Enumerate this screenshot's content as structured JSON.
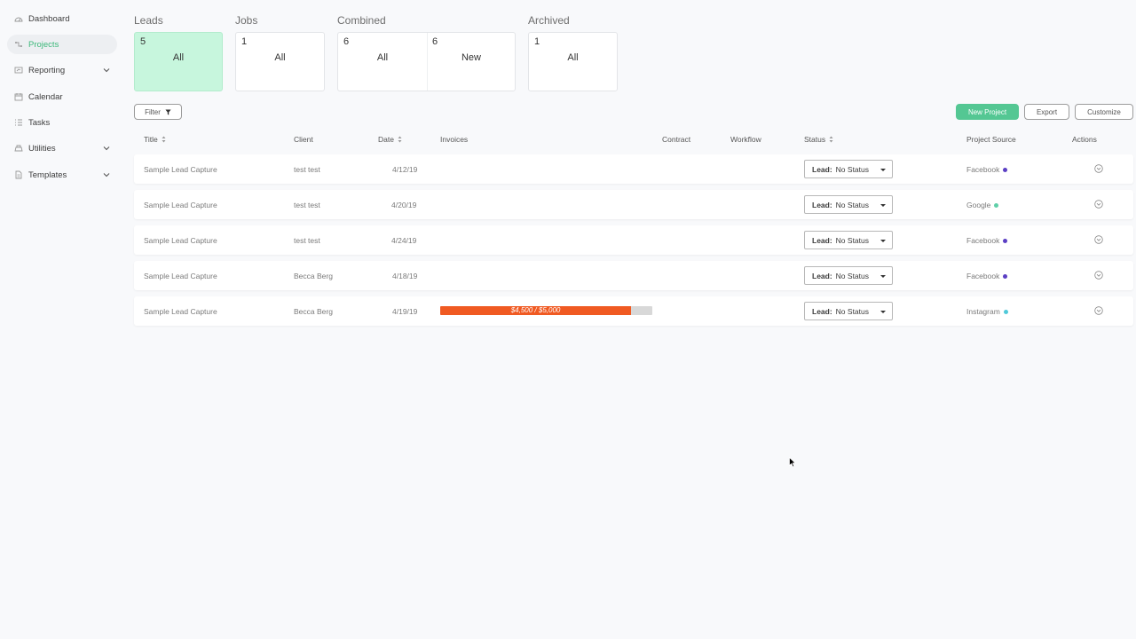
{
  "sidebar": {
    "items": [
      {
        "label": "Dashboard",
        "icon": "dashboard-icon",
        "active": false
      },
      {
        "label": "Projects",
        "icon": "projects-icon",
        "active": true
      },
      {
        "label": "Reporting",
        "icon": "reporting-icon",
        "active": false,
        "expandable": true
      },
      {
        "label": "Calendar",
        "icon": "calendar-icon",
        "active": false
      },
      {
        "label": "Tasks",
        "icon": "tasks-icon",
        "active": false
      },
      {
        "label": "Utilities",
        "icon": "utilities-icon",
        "active": false,
        "expandable": true
      },
      {
        "label": "Templates",
        "icon": "templates-icon",
        "active": false,
        "expandable": true
      }
    ]
  },
  "categories": {
    "leads": {
      "label": "Leads",
      "all_count": "5",
      "all_label": "All"
    },
    "jobs": {
      "label": "Jobs",
      "all_count": "1",
      "all_label": "All"
    },
    "combined": {
      "label": "Combined",
      "all_count": "6",
      "all_label": "All",
      "new_count": "6",
      "new_label": "New"
    },
    "archived": {
      "label": "Archived",
      "all_count": "1",
      "all_label": "All"
    }
  },
  "toolbar": {
    "filter_label": "Filter",
    "new_project_label": "New Project",
    "export_label": "Export",
    "customize_label": "Customize"
  },
  "table": {
    "headers": {
      "title": "Title",
      "client": "Client",
      "date": "Date",
      "invoices": "Invoices",
      "contract": "Contract",
      "workflow": "Workflow",
      "status": "Status",
      "source": "Project Source",
      "actions": "Actions"
    },
    "rows": [
      {
        "title": "Sample Lead Capture",
        "client": "test test",
        "date": "4/12/19",
        "invoice": "",
        "status_prefix": "Lead:",
        "status": "No Status",
        "source": "Facebook",
        "source_color": "#5b3fc4"
      },
      {
        "title": "Sample Lead Capture",
        "client": "test test",
        "date": "4/20/19",
        "invoice": "",
        "status_prefix": "Lead:",
        "status": "No Status",
        "source": "Google",
        "source_color": "#5fcfa8"
      },
      {
        "title": "Sample Lead Capture",
        "client": "test test",
        "date": "4/24/19",
        "invoice": "",
        "status_prefix": "Lead:",
        "status": "No Status",
        "source": "Facebook",
        "source_color": "#5b3fc4"
      },
      {
        "title": "Sample Lead Capture",
        "client": "Becca Berg",
        "date": "4/18/19",
        "invoice": "",
        "status_prefix": "Lead:",
        "status": "No Status",
        "source": "Facebook",
        "source_color": "#5b3fc4"
      },
      {
        "title": "Sample Lead Capture",
        "client": "Becca Berg",
        "date": "4/19/19",
        "invoice": "$4,500 / $5,000",
        "invoice_paid": 4500,
        "invoice_total": 5000,
        "status_prefix": "Lead:",
        "status": "No Status",
        "source": "Instagram",
        "source_color": "#4fc9d9"
      }
    ]
  },
  "colors": {
    "accent": "#54c793",
    "selected_card": "#c7f6dd",
    "progress": "#f05a22"
  }
}
